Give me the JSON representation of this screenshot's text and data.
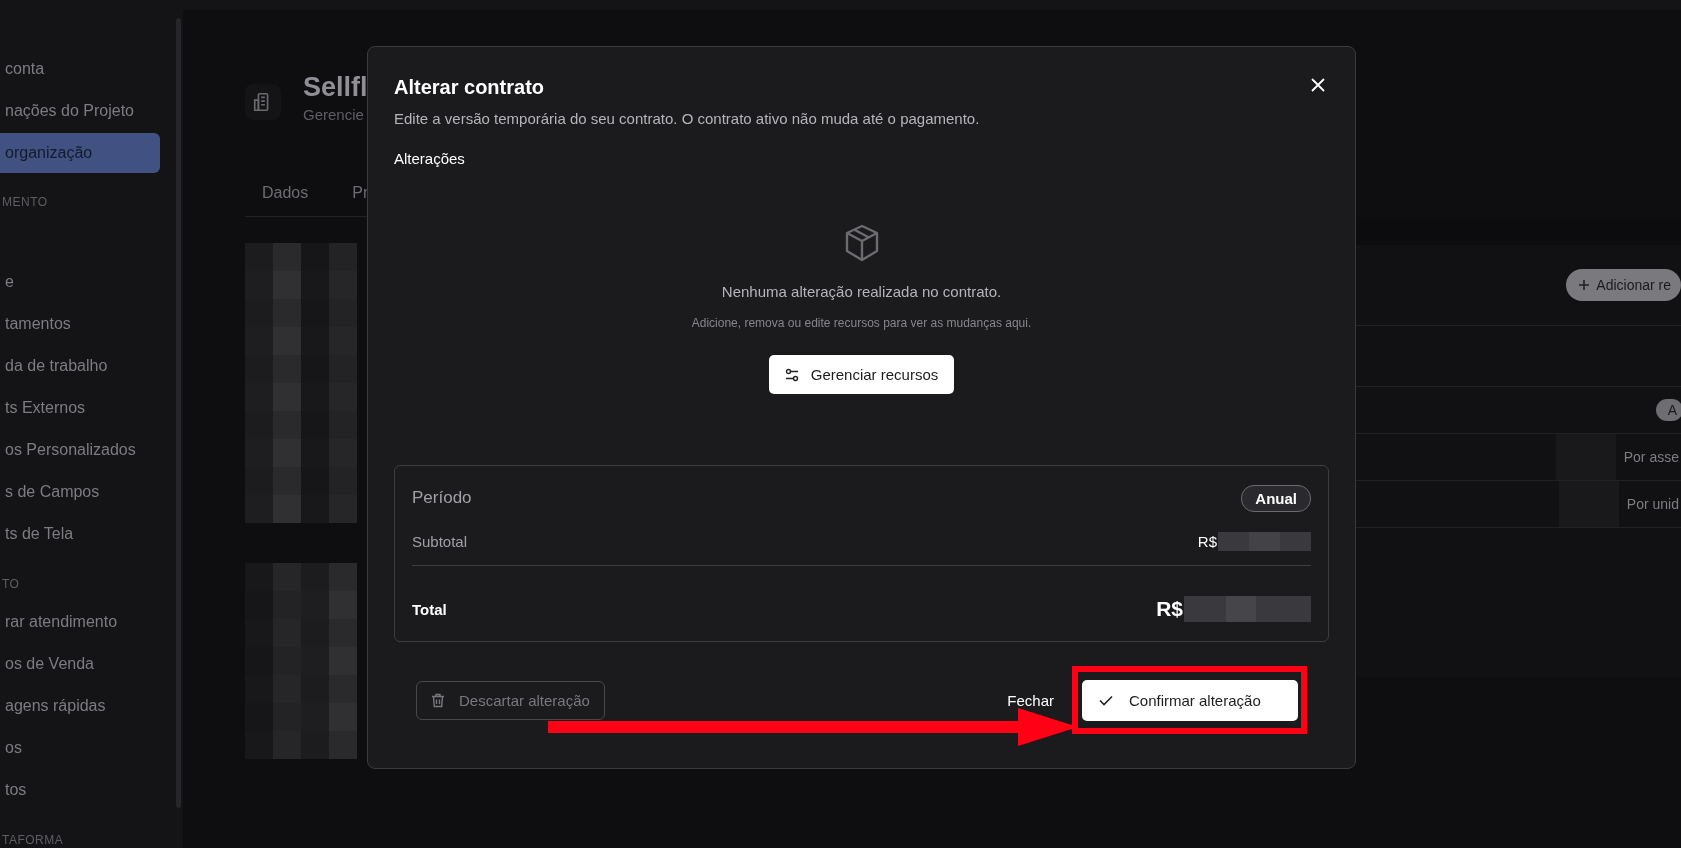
{
  "sidebar": {
    "groups": [
      {
        "items": [
          {
            "label": "conta",
            "selected": false
          },
          {
            "label": "nações do Projeto",
            "selected": false
          },
          {
            "label": "organização",
            "selected": true
          }
        ]
      },
      {
        "title": "MENTO",
        "items": [
          {
            "label": "e",
            "selected": false
          },
          {
            "label": "tamentos",
            "selected": false
          },
          {
            "label": "da de trabalho",
            "selected": false
          },
          {
            "label": "ts Externos",
            "selected": false
          },
          {
            "label": "os Personalizados",
            "selected": false
          },
          {
            "label": "s de Campos",
            "selected": false
          },
          {
            "label": "ts de Tela",
            "selected": false
          }
        ]
      },
      {
        "title": "TO",
        "items": [
          {
            "label": "rar atendimento",
            "selected": false
          },
          {
            "label": "os de Venda",
            "selected": false
          },
          {
            "label": "agens rápidas",
            "selected": false
          },
          {
            "label": "os",
            "selected": false
          },
          {
            "label": "tos",
            "selected": false
          }
        ]
      },
      {
        "title": "TAFORMA"
      }
    ]
  },
  "page_header": {
    "title": "Sellfl",
    "subtitle": "Gerencie"
  },
  "tabs": [
    {
      "label": "Dados",
      "selected": false
    },
    {
      "label": "Pr",
      "selected": false
    }
  ],
  "resources_panel": {
    "add_button": "Adicionar re",
    "pill": "A",
    "rows": [
      {
        "text": "Por asse"
      },
      {
        "text": "Por unid"
      }
    ]
  },
  "dialog": {
    "title": "Alterar contrato",
    "description": "Edite a versão temporária do seu contrato. O contrato ativo não muda até o pagamento.",
    "section_label": "Alterações",
    "empty_state": {
      "message": "Nenhuma alteração realizada no contrato.",
      "hint": "Adicione, remova ou edite recursos para ver as mudanças aqui.",
      "action": "Gerenciar recursos"
    },
    "summary": {
      "period_label": "Período",
      "period_value": "Anual",
      "subtotal_label": "Subtotal",
      "subtotal_currency": "R$",
      "total_label": "Total",
      "total_currency": "R$"
    },
    "actions": {
      "discard": {
        "label": "Descartar alteração",
        "disabled": true
      },
      "close": "Fechar",
      "confirm": "Confirmar alteração"
    }
  }
}
